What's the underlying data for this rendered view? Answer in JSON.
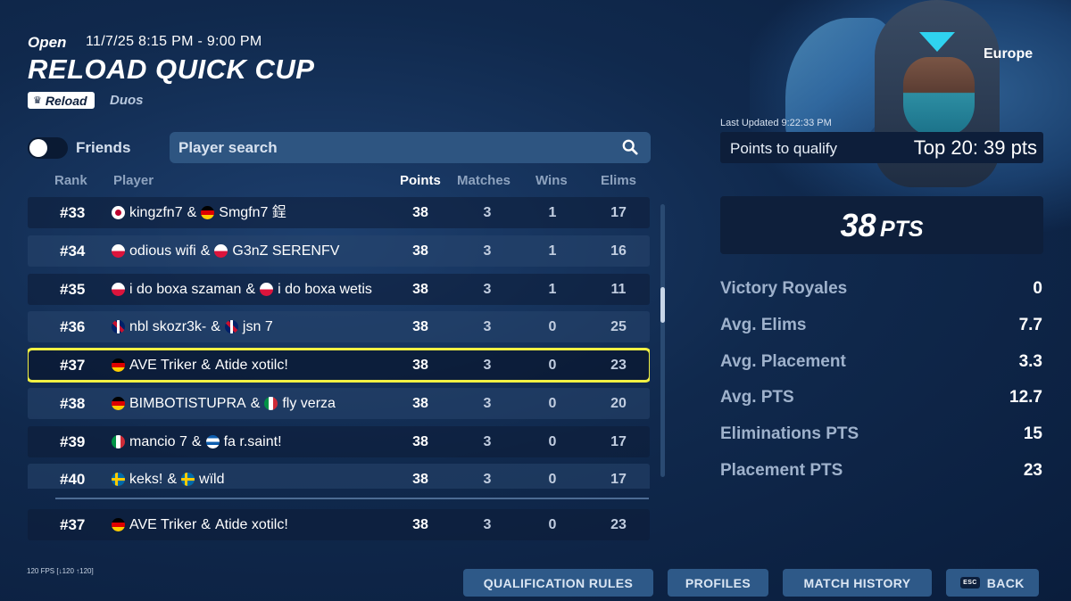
{
  "header": {
    "status": "Open",
    "date_time": "11/7/25 8:15 PM - 9:00 PM",
    "title": "RELOAD QUICK CUP",
    "mode_badge": "Reload",
    "mode_type": "Duos",
    "region": "Europe"
  },
  "filters": {
    "friends_label": "Friends",
    "friends_toggle_on": false,
    "search_placeholder": "Player search"
  },
  "table": {
    "columns": [
      "Rank",
      "Player",
      "Points",
      "Matches",
      "Wins",
      "Elims"
    ],
    "rows": [
      {
        "rank": "#33",
        "p1_flag": "jp",
        "p1": "kingzfn7",
        "sep": "&",
        "p2_flag": "de",
        "p2": "Smgfn7 鋥",
        "points": "38",
        "matches": "3",
        "wins": "1",
        "elims": "17"
      },
      {
        "rank": "#34",
        "p1_flag": "pl",
        "p1": "odious wifi",
        "sep": "&",
        "p2_flag": "pl",
        "p2": "G3nZ SERENFV",
        "points": "38",
        "matches": "3",
        "wins": "1",
        "elims": "16"
      },
      {
        "rank": "#35",
        "p1_flag": "pl",
        "p1": "i do boxa szaman",
        "sep": "&",
        "p2_flag": "pl",
        "p2": "i do boxa wetis",
        "points": "38",
        "matches": "3",
        "wins": "1",
        "elims": "11"
      },
      {
        "rank": "#36",
        "p1_flag": "gb",
        "p1": "nbl skozr3k-",
        "sep": "&",
        "p2_flag": "gb",
        "p2": "jsn 7",
        "points": "38",
        "matches": "3",
        "wins": "0",
        "elims": "25"
      },
      {
        "rank": "#37",
        "p1_flag": "de",
        "p1": "AVE Triker",
        "sep": "&",
        "p2_flag": "",
        "p2": "Atide xotilc!",
        "points": "38",
        "matches": "3",
        "wins": "0",
        "elims": "23"
      },
      {
        "rank": "#38",
        "p1_flag": "de",
        "p1": "BIMBOTISTUPRA",
        "sep": "&",
        "p2_flag": "it",
        "p2": "fly verza",
        "points": "38",
        "matches": "3",
        "wins": "0",
        "elims": "20"
      },
      {
        "rank": "#39",
        "p1_flag": "it",
        "p1": "mancio 7",
        "sep": "&",
        "p2_flag": "gr",
        "p2": "fa r.saint!",
        "points": "38",
        "matches": "3",
        "wins": "0",
        "elims": "17"
      },
      {
        "rank": "#40",
        "p1_flag": "se",
        "p1": "keks!",
        "sep": "&",
        "p2_flag": "se",
        "p2": "wïld",
        "points": "38",
        "matches": "3",
        "wins": "0",
        "elims": "17"
      }
    ],
    "highlight_index": 4,
    "pinned_row": {
      "rank": "#37",
      "p1_flag": "de",
      "p1": "AVE Triker",
      "sep": "&",
      "p2_flag": "",
      "p2": "Atide xotilc!",
      "points": "38",
      "matches": "3",
      "wins": "0",
      "elims": "23"
    }
  },
  "summary": {
    "last_updated": "Last Updated 9:22:33 PM",
    "qualify_label": "Points to qualify",
    "qualify_value": "Top 20: 39 pts",
    "total_points": "38",
    "total_points_unit": "PTS",
    "stats": [
      {
        "label": "Victory Royales",
        "value": "0"
      },
      {
        "label": "Avg. Elims",
        "value": "7.7"
      },
      {
        "label": "Avg. Placement",
        "value": "3.3"
      },
      {
        "label": "Avg. PTS",
        "value": "12.7"
      },
      {
        "label": "Eliminations PTS",
        "value": "15"
      },
      {
        "label": "Placement PTS",
        "value": "23"
      }
    ]
  },
  "footer": {
    "fps": "120 FPS [↓120 ↑120]",
    "buttons": {
      "qualification_rules": "QUALIFICATION RULES",
      "profiles": "PROFILES",
      "match_history": "MATCH HISTORY",
      "esc_key": "ESC",
      "back": "BACK"
    }
  },
  "colors": {
    "highlight_outline": "#f1f043",
    "button_bg": "#2e5988",
    "background": "#10294d"
  },
  "scroll_position": 0.35
}
